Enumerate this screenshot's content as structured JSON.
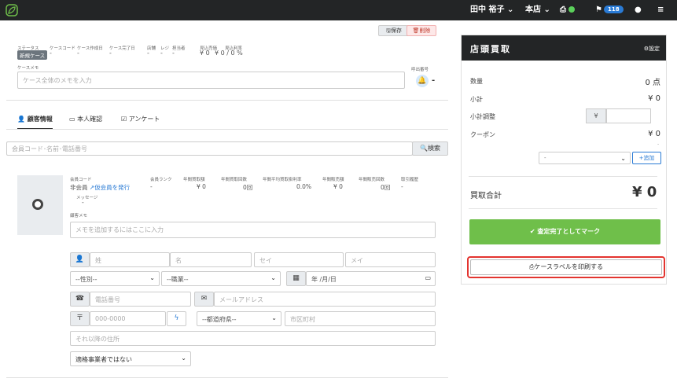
{
  "topbar": {
    "user": "田中 裕子",
    "store": "本店",
    "notif_count": "118"
  },
  "case": {
    "status_label": "ステータス",
    "status_value": "新規ケース",
    "case_code_label": "ケースコード",
    "case_code_value": "-",
    "created_label": "ケース作成日",
    "created_value": "-",
    "completed_label": "ケース完了日",
    "completed_value": "-",
    "store_label": "店舗",
    "store_value": "-",
    "register_label": "レジ",
    "register_value": "-",
    "staff_label": "担当者",
    "staff_value": "-",
    "est_sales_label": "見込売価",
    "est_sales_value": "¥ 0",
    "est_profit_label": "見込利率",
    "est_profit_value": "¥ 0 / 0 %",
    "save_label": "保存",
    "delete_label": "削除",
    "memo_label": "ケースメモ",
    "memo_placeholder": "ケース全体のメモを入力",
    "call_no_label": "呼出番号",
    "call_no_value": "-"
  },
  "tabs": [
    {
      "label": "顧客情報"
    },
    {
      "label": "本人確認"
    },
    {
      "label": "アンケート"
    }
  ],
  "search": {
    "placeholder": "会員コード･名前･電話番号",
    "button_label": "検索"
  },
  "customer": {
    "member_code_label": "会員コード",
    "member_code_value": "非会員",
    "temp_member_link": "仮会員を発行",
    "message_label": "メッセージ",
    "message_value": "-",
    "rank_label": "会員ランク",
    "rank_value": "-",
    "annual_buy_label": "年間買取額",
    "annual_buy_value": "¥ 0",
    "annual_buy_count_label": "年間買取回数",
    "annual_buy_count_value": "0回",
    "annual_avg_rate_label": "年間平均買取掛利率",
    "annual_avg_rate_value": "0.0%",
    "annual_sales_label": "年間販売額",
    "annual_sales_value": "¥ 0",
    "annual_sales_count_label": "年間販売回数",
    "annual_sales_count_value": "0回",
    "history_label": "取引履歴",
    "history_value": "-",
    "memo_label": "顧客メモ",
    "memo_placeholder": "メモを追加するにはここに入力"
  },
  "form": {
    "last_name": "姓",
    "first_name": "名",
    "last_kana": "セイ",
    "first_kana": "メイ",
    "gender": "--性別--",
    "occupation": "--職業--",
    "birthday": "年 /月/日",
    "phone": "電話番号",
    "email": "メールアドレス",
    "postal": "000-0000",
    "prefecture": "--都道府県--",
    "city": "市区町村",
    "address_rest": "それ以降の住所",
    "dealer": "適格事業者ではない"
  },
  "side": {
    "title": "店頭買取",
    "settings_label": "設定",
    "qty_label": "数量",
    "qty_value": "0 点",
    "subtotal_label": "小計",
    "subtotal_value": "¥ 0",
    "adjust_label": "小計調整",
    "adjust_yen": "¥",
    "coupon_label": "クーポン",
    "coupon_value": "¥ 0",
    "coupon_dash": "-",
    "coupon_select": "-",
    "add_label": "追加",
    "total_label": "買取合計",
    "total_value": "¥ 0",
    "done_label": "査定完了としてマーク",
    "print_label": "ケースラベルを印刷する"
  },
  "colors": {
    "topbar": "#232526",
    "accent_blue": "#2a7bd5",
    "done_green": "#6fbf4a",
    "highlight_red": "#e3342f"
  }
}
